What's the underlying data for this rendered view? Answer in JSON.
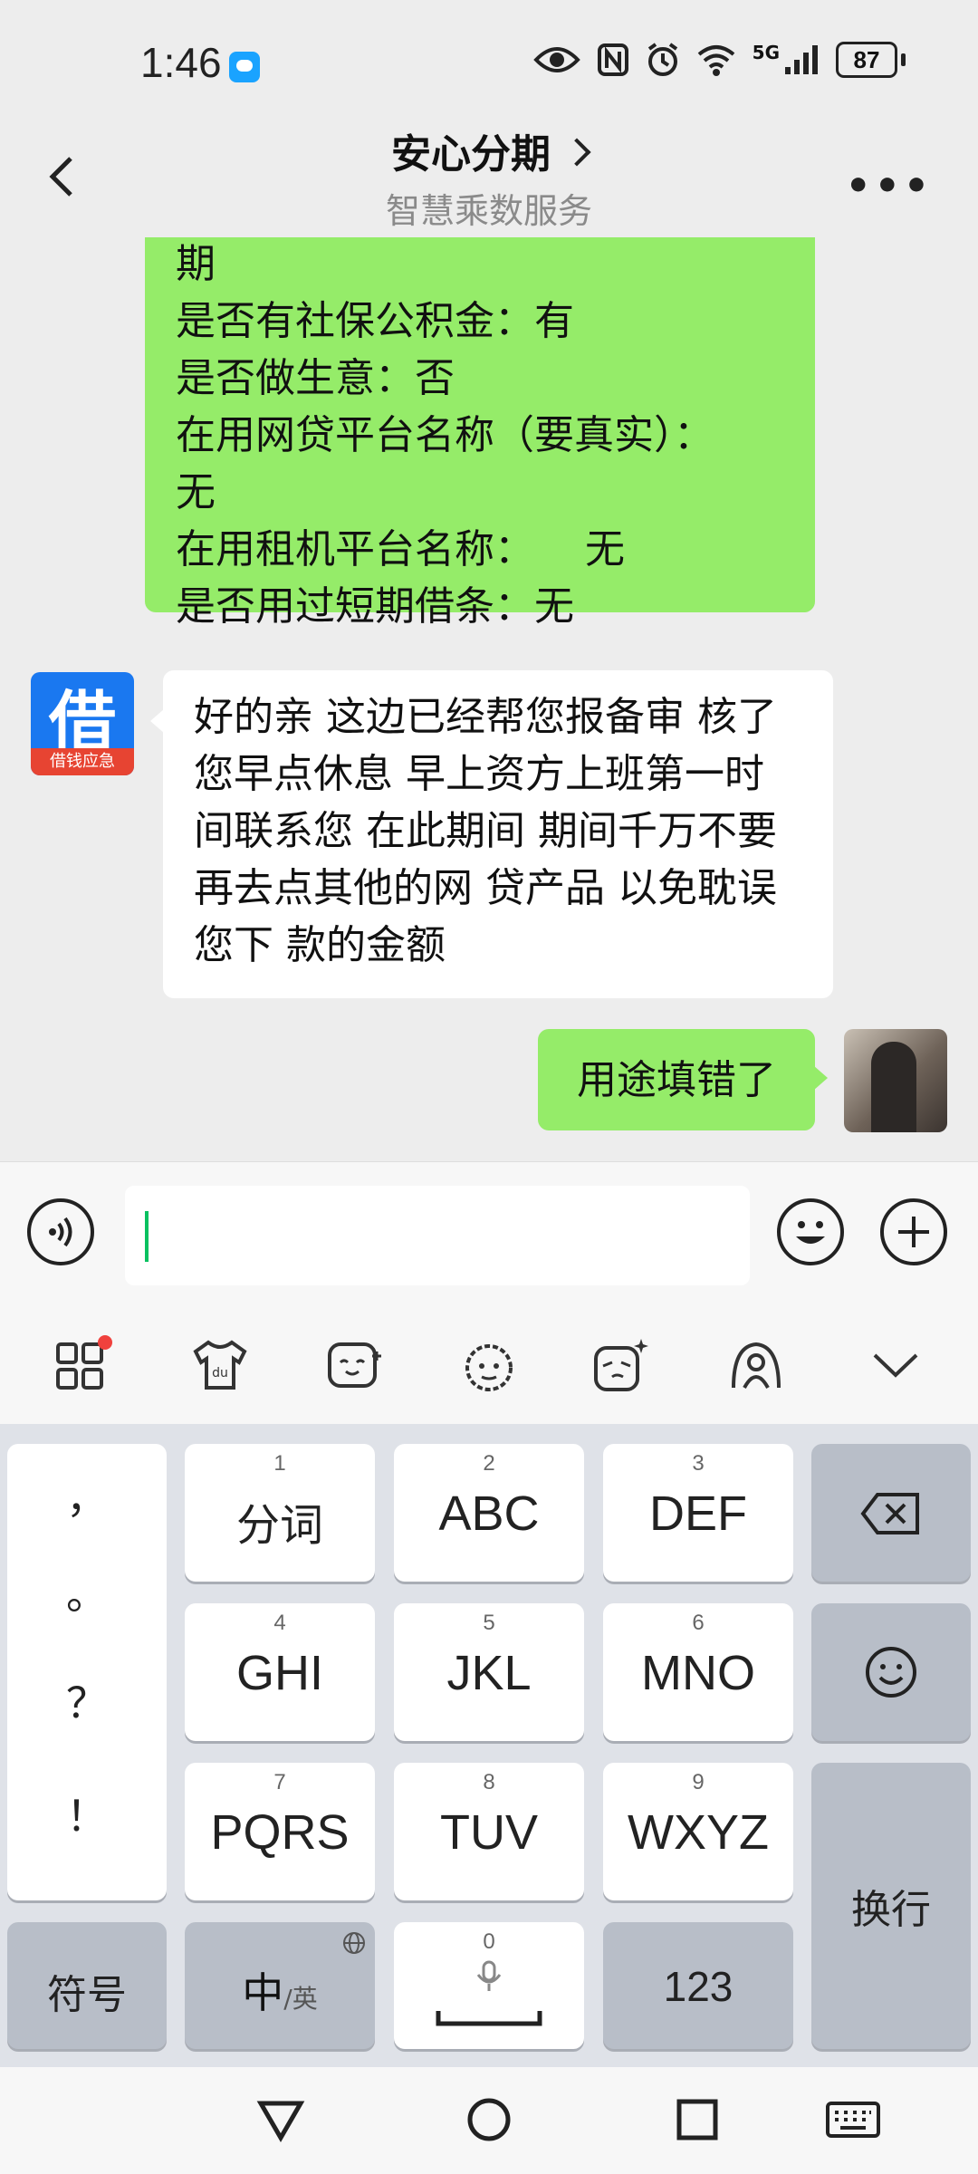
{
  "status_bar": {
    "time": "1:46",
    "network": "5G",
    "battery": "87"
  },
  "header": {
    "title": "安心分期",
    "subtitle": "智慧乘数服务"
  },
  "messages": {
    "form_lines": [
      "期",
      "是否有社保公积金：有",
      "是否做生意：否",
      "在用网贷平台名称（要真实）：",
      "无",
      "在用租机平台名称：    无",
      "是否用过短期借条：无"
    ],
    "reply_text": "好的亲 这边已经帮您报备审 核了 您早点休息 早上资方上班第一时间联系您  在此期间 期间千万不要再去点其他的网 贷产品 以免耽误您下 款的金额",
    "agent_avatar": {
      "char": "借",
      "tag": "借钱应急"
    },
    "user_message": "用途填错了"
  },
  "input": {
    "value": ""
  },
  "keyboard": {
    "punctuation": [
      "，",
      "。",
      "？",
      "！"
    ],
    "keys": [
      {
        "num": "1",
        "label": "分词"
      },
      {
        "num": "2",
        "label": "ABC"
      },
      {
        "num": "3",
        "label": "DEF"
      },
      {
        "num": "4",
        "label": "GHI"
      },
      {
        "num": "5",
        "label": "JKL"
      },
      {
        "num": "6",
        "label": "MNO"
      },
      {
        "num": "7",
        "label": "PQRS"
      },
      {
        "num": "8",
        "label": "TUV"
      },
      {
        "num": "9",
        "label": "WXYZ"
      }
    ],
    "symbols_label": "符号",
    "lang_main": "中",
    "lang_alt": "/英",
    "space_num": "0",
    "num_label": "123",
    "enter_label": "换行"
  },
  "colors": {
    "bubble_green": "#95ec69",
    "accent": "#07c160",
    "notice_dot": "#f0413d"
  }
}
